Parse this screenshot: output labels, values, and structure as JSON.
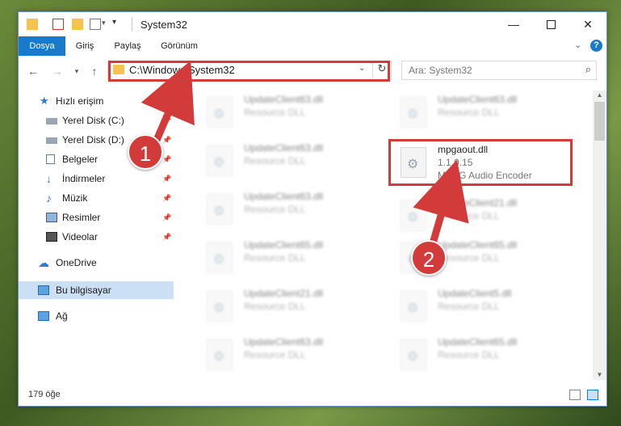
{
  "window": {
    "title": "System32"
  },
  "ribbon": {
    "tabs": [
      "Dosya",
      "Giriş",
      "Paylaş",
      "Görünüm"
    ]
  },
  "address": {
    "path": "C:\\Windows\\System32"
  },
  "search": {
    "placeholder": "Ara: System32"
  },
  "sidebar": {
    "items": [
      {
        "label": "Hızlı erişim"
      },
      {
        "label": "Yerel Disk (C:)"
      },
      {
        "label": "Yerel Disk (D:)"
      },
      {
        "label": "Belgeler"
      },
      {
        "label": "İndirmeler"
      },
      {
        "label": "Müzik"
      },
      {
        "label": "Resimler"
      },
      {
        "label": "Videolar"
      },
      {
        "label": "OneDrive"
      },
      {
        "label": "Bu bilgisayar"
      },
      {
        "label": "Ağ"
      }
    ]
  },
  "files": {
    "left": [
      {
        "name": "UpdateClient63.dll",
        "type": "Resource DLL"
      },
      {
        "name": "UpdateClient63.dll",
        "type": "Resource DLL"
      },
      {
        "name": "UpdateClient63.dll",
        "type": "Resource DLL"
      },
      {
        "name": "UpdateClient65.dll",
        "type": "Resource DLL"
      },
      {
        "name": "UpdateClient21.dll",
        "type": "Resource DLL"
      },
      {
        "name": "UpdateClient63.dll",
        "type": "Resource DLL"
      }
    ],
    "right": [
      {
        "name": "UpdateClient63.dll",
        "type": "Resource DLL"
      },
      {
        "name": "UpdateClient21.dll",
        "type": "Resource DLL"
      },
      {
        "name": "UpdateClient65.dll",
        "type": "Resource DLL"
      },
      {
        "name": "UpdateClient5.dll",
        "type": "Resource DLL"
      },
      {
        "name": "UpdateClient65.dll",
        "type": "Resource DLL"
      }
    ],
    "highlighted": {
      "name": "mpgaout.dll",
      "version": "1.1.0.15",
      "description": "MPEG Audio Encoder"
    }
  },
  "status": {
    "count": "179 öğe"
  },
  "annotations": {
    "badge1": "1",
    "badge2": "2",
    "color": "#d33a3a"
  }
}
